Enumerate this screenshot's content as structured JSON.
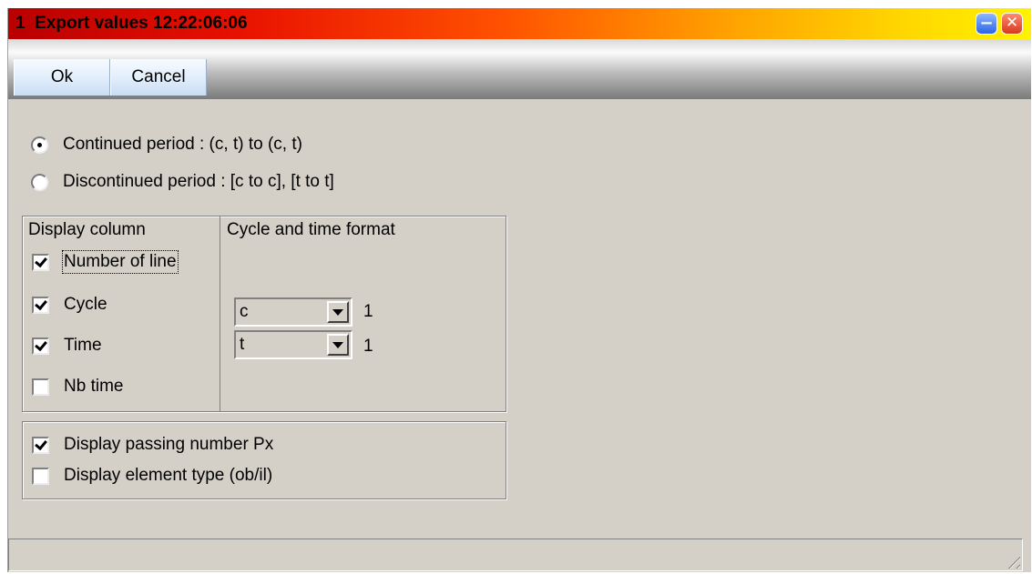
{
  "window": {
    "title": "1  Export values 12:22:06:06",
    "minimize_glyph": "−",
    "close_glyph": "✕"
  },
  "toolbar": {
    "ok_label": "Ok",
    "cancel_label": "Cancel"
  },
  "period": {
    "continued_label": "Continued period : (c, t) to (c, t)",
    "continued_selected": true,
    "discontinued_label": "Discontinued period : [c to c], [t to t]",
    "discontinued_selected": false
  },
  "display_column": {
    "title": "Display column",
    "items": [
      {
        "label": "Number of line",
        "checked": true
      },
      {
        "label": "Cycle",
        "checked": true
      },
      {
        "label": "Time",
        "checked": true
      },
      {
        "label": "Nb time",
        "checked": false
      }
    ]
  },
  "format": {
    "title": "Cycle and time format",
    "cycle_value": "c",
    "cycle_number": "1",
    "time_value": "t",
    "time_number": "1"
  },
  "options": {
    "items": [
      {
        "label": "Display passing number Px",
        "checked": true
      },
      {
        "label": "Display element type (ob/il)",
        "checked": false
      }
    ]
  },
  "colors": {
    "face": "#d4d0c8",
    "title_start": "#b80000",
    "title_end": "#fff200"
  }
}
